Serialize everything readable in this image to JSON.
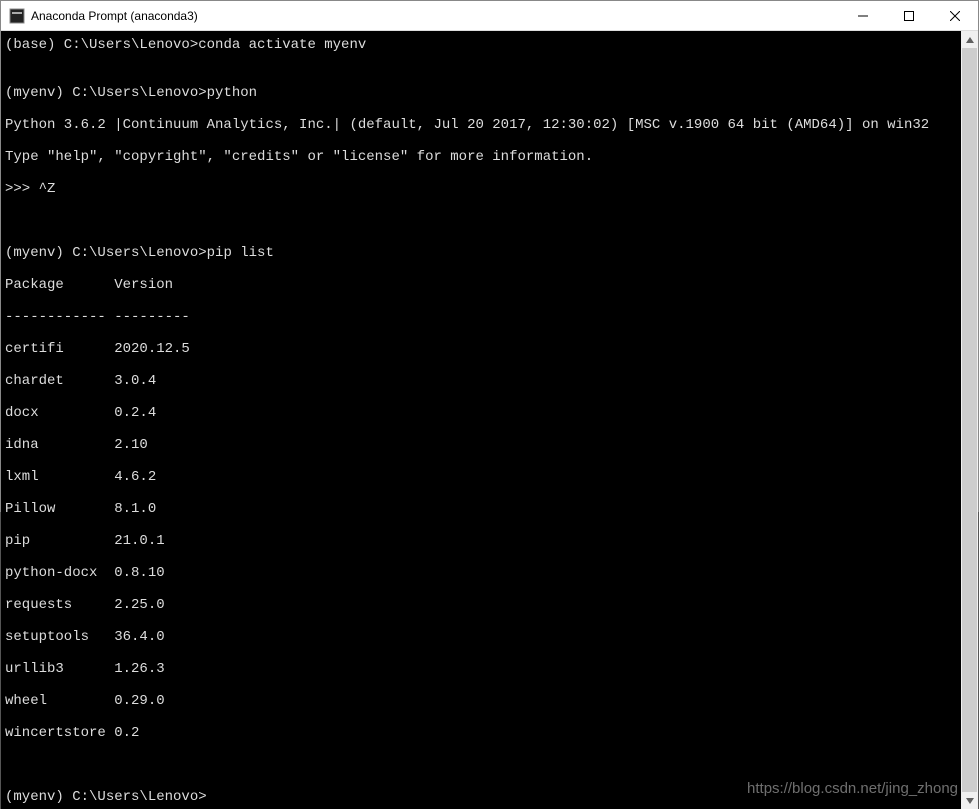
{
  "titlebar": {
    "title": "Anaconda Prompt (anaconda3)"
  },
  "terminal": {
    "line1_prompt": "(base) C:\\Users\\Lenovo>",
    "line1_cmd": "conda activate myenv",
    "blank1": "",
    "line2_prompt": "(myenv) C:\\Users\\Lenovo>",
    "line2_cmd": "python",
    "python_banner1": "Python 3.6.2 |Continuum Analytics, Inc.| (default, Jul 20 2017, 12:30:02) [MSC v.1900 64 bit (AMD64)] on win32",
    "python_banner2": "Type \"help\", \"copyright\", \"credits\" or \"license\" for more information.",
    "python_repl": ">>> ^Z",
    "blank2": "",
    "blank3": "",
    "line3_prompt": "(myenv) C:\\Users\\Lenovo>",
    "line3_cmd": "pip list",
    "pip_header": "Package      Version",
    "pip_divider": "------------ ---------",
    "packages": [
      {
        "name": "certifi",
        "version": "2020.12.5"
      },
      {
        "name": "chardet",
        "version": "3.0.4"
      },
      {
        "name": "docx",
        "version": "0.2.4"
      },
      {
        "name": "idna",
        "version": "2.10"
      },
      {
        "name": "lxml",
        "version": "4.6.2"
      },
      {
        "name": "Pillow",
        "version": "8.1.0"
      },
      {
        "name": "pip",
        "version": "21.0.1"
      },
      {
        "name": "python-docx",
        "version": "0.8.10"
      },
      {
        "name": "requests",
        "version": "2.25.0"
      },
      {
        "name": "setuptools",
        "version": "36.4.0"
      },
      {
        "name": "urllib3",
        "version": "1.26.3"
      },
      {
        "name": "wheel",
        "version": "0.29.0"
      },
      {
        "name": "wincertstore",
        "version": "0.2"
      }
    ],
    "blank4": "",
    "line4_prompt": "(myenv) C:\\Users\\Lenovo>",
    "line4_cmd": ""
  },
  "watermark": "https://blog.csdn.net/jing_zhong"
}
